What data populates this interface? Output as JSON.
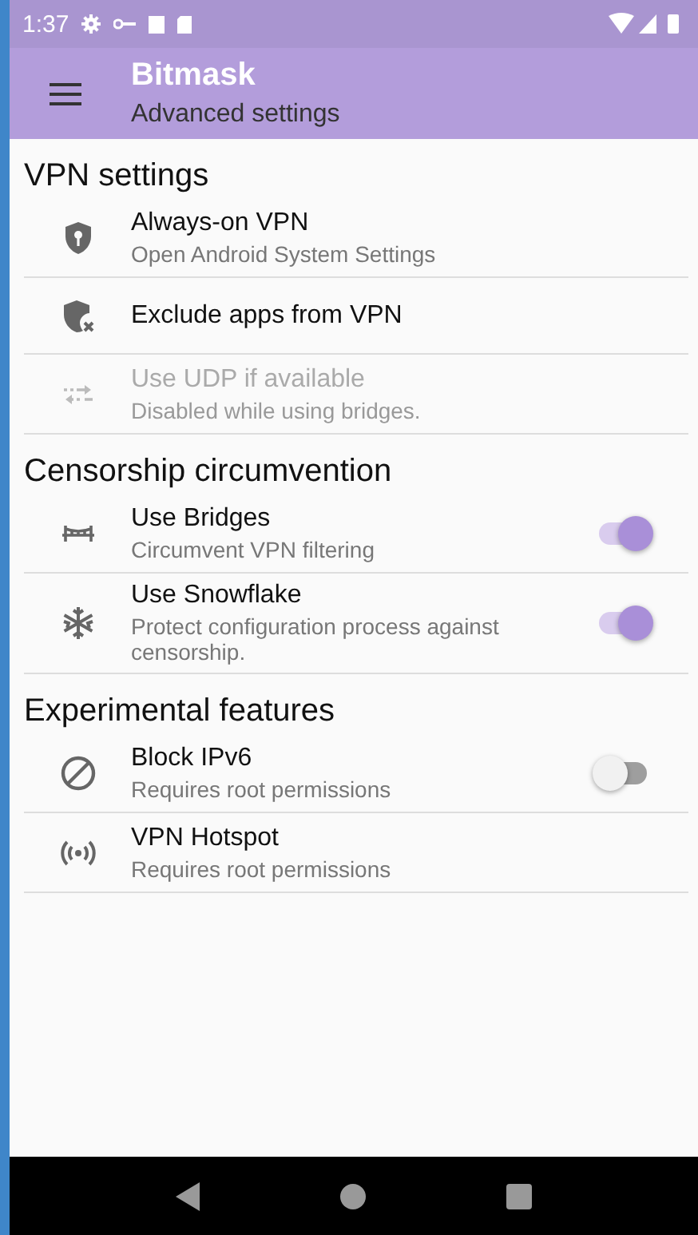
{
  "status_bar": {
    "time": "1:37"
  },
  "toolbar": {
    "title": "Bitmask",
    "subtitle": "Advanced settings"
  },
  "sections": [
    {
      "title": "VPN settings",
      "items": [
        {
          "kind": "link",
          "title": "Always-on VPN",
          "summary": "Open Android System Settings",
          "disabled": false
        },
        {
          "kind": "link",
          "title": "Exclude apps from VPN",
          "disabled": false
        },
        {
          "kind": "link",
          "title": "Use UDP if available",
          "summary": "Disabled while using bridges.",
          "disabled": true
        }
      ]
    },
    {
      "title": "Censorship circumvention",
      "items": [
        {
          "kind": "toggle",
          "title": "Use Bridges",
          "summary": "Circumvent VPN filtering",
          "disabled": false,
          "on": true
        },
        {
          "kind": "toggle",
          "title": "Use Snowflake",
          "summary": "Protect configuration process against censorship.",
          "disabled": false,
          "on": true
        }
      ]
    },
    {
      "title": "Experimental features",
      "items": [
        {
          "kind": "toggle",
          "title": "Block IPv6",
          "summary": "Requires root permissions",
          "disabled": false,
          "on": false
        },
        {
          "kind": "link",
          "title": "VPN Hotspot",
          "summary": "Requires root permissions",
          "disabled": false
        }
      ]
    }
  ]
}
